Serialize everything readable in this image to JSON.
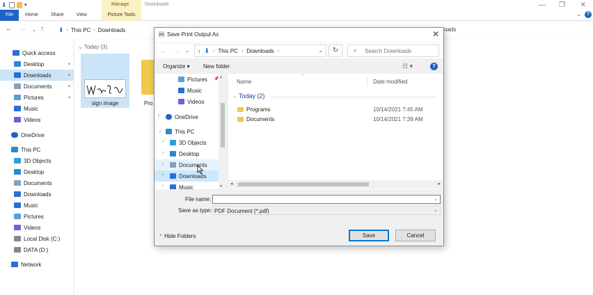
{
  "explorer": {
    "ribbon": {
      "tabs": [
        "File",
        "Home",
        "Share",
        "View"
      ],
      "contextual_group": "Manage",
      "contextual_tab": "Picture Tools",
      "window_title": "Downloads"
    },
    "breadcrumb": [
      "This PC",
      "Downloads"
    ],
    "address_right": "oads",
    "sidebar": [
      {
        "label": "Quick access",
        "icon": "star-icon",
        "pinned": false,
        "selected": false
      },
      {
        "label": "Desktop",
        "icon": "desktop-icon",
        "pinned": true,
        "selected": false
      },
      {
        "label": "Downloads",
        "icon": "download-arrow-icon",
        "pinned": true,
        "selected": true
      },
      {
        "label": "Documents",
        "icon": "documents-icon",
        "pinned": true,
        "selected": false
      },
      {
        "label": "Pictures",
        "icon": "pictures-icon",
        "pinned": true,
        "selected": false
      },
      {
        "label": "Music",
        "icon": "music-icon",
        "pinned": false,
        "selected": false
      },
      {
        "label": "Videos",
        "icon": "videos-icon",
        "pinned": false,
        "selected": false
      },
      {
        "label": "OneDrive",
        "icon": "cloud-icon",
        "pinned": false,
        "selected": false
      },
      {
        "label": "This PC",
        "icon": "computer-icon",
        "pinned": false,
        "selected": false
      },
      {
        "label": "3D Objects",
        "icon": "cube-icon",
        "pinned": false,
        "selected": false
      },
      {
        "label": "Desktop",
        "icon": "desktop-icon",
        "pinned": false,
        "selected": false
      },
      {
        "label": "Documents",
        "icon": "documents-icon",
        "pinned": false,
        "selected": false
      },
      {
        "label": "Downloads",
        "icon": "download-arrow-icon",
        "pinned": false,
        "selected": false
      },
      {
        "label": "Music",
        "icon": "music-icon",
        "pinned": false,
        "selected": false
      },
      {
        "label": "Pictures",
        "icon": "pictures-icon",
        "pinned": false,
        "selected": false
      },
      {
        "label": "Videos",
        "icon": "videos-icon",
        "pinned": false,
        "selected": false
      },
      {
        "label": "Local Disk (C:)",
        "icon": "drive-icon",
        "pinned": false,
        "selected": false
      },
      {
        "label": "DATA (D:)",
        "icon": "drive-icon",
        "pinned": false,
        "selected": false
      },
      {
        "label": "Network",
        "icon": "network-icon",
        "pinned": false,
        "selected": false
      }
    ],
    "content": {
      "group_header": "Today (3)",
      "items": [
        {
          "label": "sign image",
          "type": "image"
        },
        {
          "label": "Pro",
          "type": "folder"
        }
      ]
    }
  },
  "dialog": {
    "title": "Save Print Output As",
    "address": [
      "This PC",
      "Downloads"
    ],
    "search_placeholder": "Search Downloads",
    "toolbar": {
      "organize": "Organize ▾",
      "new_folder": "New folder"
    },
    "tree": [
      {
        "label": "Pictures",
        "icon": "pictures-icon",
        "expander": "",
        "state": ""
      },
      {
        "label": "Music",
        "icon": "music-icon",
        "expander": "",
        "state": ""
      },
      {
        "label": "Videos",
        "icon": "videos-icon",
        "expander": "",
        "state": ""
      },
      {
        "label": "OneDrive",
        "icon": "cloud-icon",
        "expander": "›",
        "state": ""
      },
      {
        "label": "This PC",
        "icon": "computer-icon",
        "expander": "⌄",
        "state": ""
      },
      {
        "label": "3D Objects",
        "icon": "cube-icon",
        "expander": "›",
        "state": ""
      },
      {
        "label": "Desktop",
        "icon": "desktop-icon",
        "expander": "›",
        "state": ""
      },
      {
        "label": "Documents",
        "icon": "documents-icon",
        "expander": "›",
        "state": "hover"
      },
      {
        "label": "Downloads",
        "icon": "download-arrow-icon",
        "expander": "›",
        "state": "selected"
      },
      {
        "label": "Music",
        "icon": "music-icon",
        "expander": "›",
        "state": ""
      }
    ],
    "columns": {
      "name": "Name",
      "date": "Date modified"
    },
    "group_label": "Today (2)",
    "files": [
      {
        "name": "Programs",
        "date": "10/14/2021 7:45 AM"
      },
      {
        "name": "Documents",
        "date": "10/14/2021 7:39 AM"
      }
    ],
    "file_name_label": "File name:",
    "file_name_value": "",
    "save_type_label": "Save as type:",
    "save_type_value": "PDF Document (*.pdf)",
    "hide_folders": "Hide Folders",
    "save_button": "Save",
    "cancel_button": "Cancel"
  },
  "colors": {
    "accent": "#1e64c8",
    "selection": "#cce4f7",
    "folder": "#f0c94a",
    "manage_tab": "#fbf1c3"
  }
}
